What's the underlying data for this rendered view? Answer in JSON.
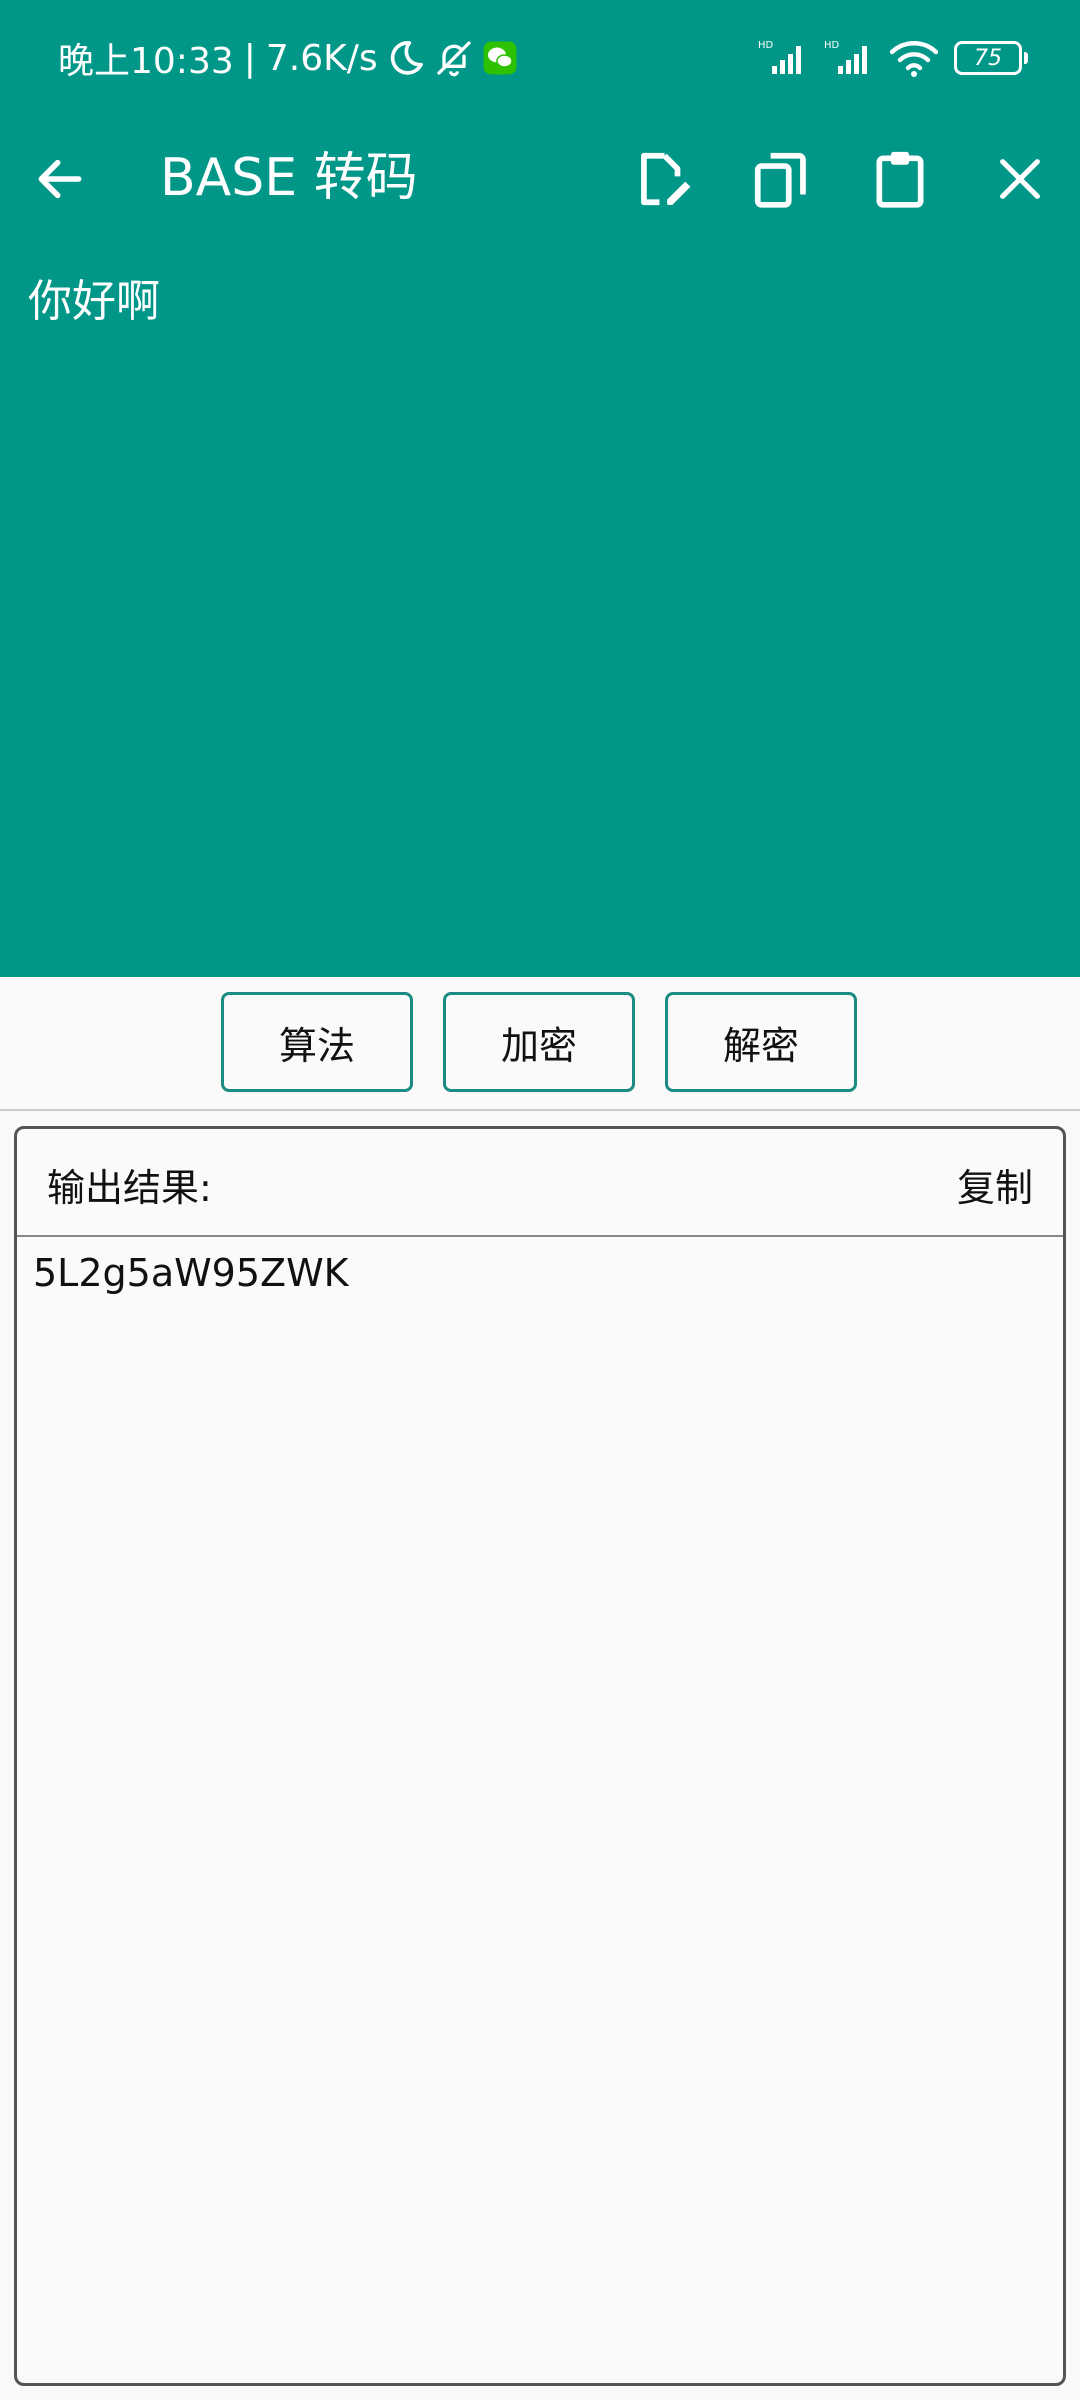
{
  "status_bar": {
    "time": "晚上10:33",
    "separator": "|",
    "speed": "7.6K/s",
    "battery": "75",
    "network_label_1": "HD",
    "network_label_2": "HD",
    "icons": [
      "moon-icon",
      "bell-off-icon",
      "wechat-icon",
      "signal-icon",
      "wifi-icon",
      "battery-icon"
    ]
  },
  "toolbar": {
    "title": "BASE 转码",
    "icons": [
      "back-arrow-icon",
      "edit-document-icon",
      "copy-icon",
      "clipboard-icon",
      "close-icon"
    ]
  },
  "input": {
    "text": "你好啊"
  },
  "actions": {
    "algorithm_label": "算法",
    "encrypt_label": "加密",
    "decrypt_label": "解密"
  },
  "output": {
    "label": "输出结果:",
    "copy_label": "复制",
    "text": "5L2g5aW95ZWK"
  },
  "colors": {
    "primary": "#009688",
    "button_border": "#1a8c82",
    "background": "#fafafa"
  }
}
